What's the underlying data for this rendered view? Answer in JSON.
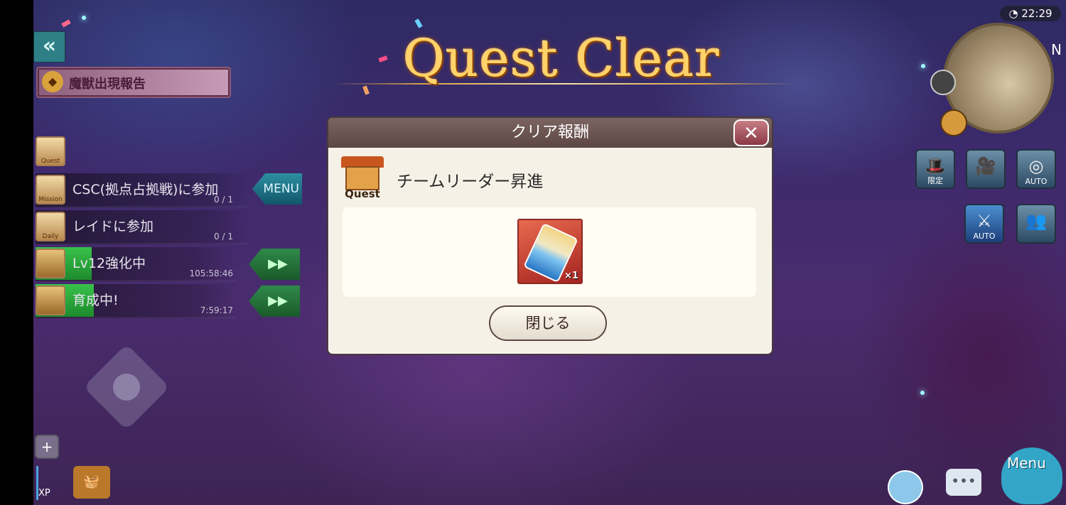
{
  "colors": {
    "accent_gold": "#ffd36a",
    "dialog_header": "#6b5452",
    "dialog_bg": "#f6f1e6",
    "progress_green": "#2eae3f",
    "menu_teal": "#1f7d90"
  },
  "hud": {
    "clock": "22:29",
    "map_north": "N",
    "back_icon": "«",
    "buttons": [
      {
        "name": "limited-button",
        "icon": "hat-icon",
        "label": "限定"
      },
      {
        "name": "camera-button",
        "icon": "camera-icon",
        "label": ""
      },
      {
        "name": "auto-button",
        "icon": "auto-target-icon",
        "label": "AUTO"
      },
      {
        "name": "auto-skill-button",
        "icon": "sword-icon",
        "label": "AUTO"
      },
      {
        "name": "party-button",
        "icon": "group-icon",
        "label": ""
      }
    ]
  },
  "report": {
    "label": "魔獣出現報告",
    "icon": "beast-icon"
  },
  "sidebar": {
    "quest_icon_label": "Quest",
    "menu_label": "MENU",
    "rows": [
      {
        "tag": "Mission",
        "label": "CSC(拠点占拠戦)に参加",
        "sub": "0 / 1",
        "progress": 0.0
      },
      {
        "tag": "Daily",
        "label": "レイドに参加",
        "sub": "0 / 1",
        "progress": 0.0
      },
      {
        "tag": "",
        "label": "Lv12強化中",
        "sub": "105:58:46",
        "progress": 0.28
      },
      {
        "tag": "",
        "label": "育成中!",
        "sub": "7:59:17",
        "progress": 0.29
      }
    ],
    "fast_forward_icon": "▶▶"
  },
  "quest_clear": {
    "title": "Quest Clear"
  },
  "dialog": {
    "title": "クリア報酬",
    "close_icon": "✕",
    "quest_icon_word": "Quest",
    "quest_name": "チームリーダー昇進",
    "reward": {
      "icon": "ticket-icon",
      "qty": "×1"
    },
    "close_button": "閉じる"
  },
  "bottom": {
    "plus": "+",
    "xp": "XP",
    "menu_label": "Menu",
    "chat_glyph": "•••"
  }
}
